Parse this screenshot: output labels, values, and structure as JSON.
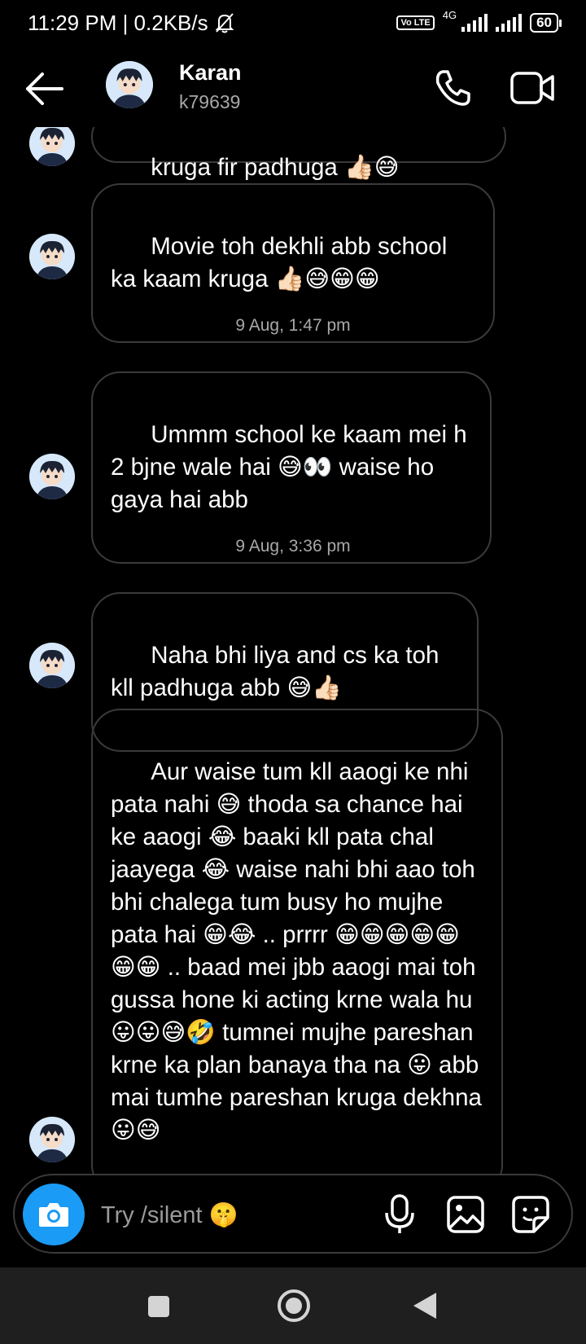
{
  "status_bar": {
    "time_speed": "11:29 PM | 0.2KB/s",
    "volte": "Vo LTE",
    "network": "4G",
    "battery": "60"
  },
  "header": {
    "name": "Karan",
    "username": "k79639"
  },
  "messages": [
    {
      "text": "kruga fir padhuga 👍🏻😅"
    },
    {
      "text": "Movie toh dekhli abb school ka kaam kruga 👍🏻😅😁😁"
    },
    {
      "text": "Ummm school ke kaam mei h 2 bjne wale hai 😅👀 waise ho gaya hai abb"
    },
    {
      "text": "Naha bhi liya and cs ka toh kll padhuga abb 😅👍🏻"
    },
    {
      "text": "Aur waise tum kll aaogi ke nhi pata nahi 😅 thoda sa chance hai ke aaogi 😂 baaki kll pata chal jaayega 😂 waise nahi bhi aao toh bhi chalega tum busy ho mujhe pata hai 😁😂 .. prrrr 😁😁😁😁😁😁😁 .. baad mei jbb aaogi mai toh gussa hone ki acting krne wala hu 😛😛😅🤣 tumnei mujhe pareshan krne ka plan banaya tha na 😛 abb mai tumhe pareshan kruga dekhna 😛😅"
    }
  ],
  "timestamps": [
    "9 Aug, 1:47 pm",
    "9 Aug, 3:36 pm"
  ],
  "composer": {
    "placeholder": "Try /silent 🤫"
  },
  "colors": {
    "background": "#000000",
    "bubble_border": "#3a3a3a",
    "accent_blue": "#1a9bf5",
    "secondary_text": "#a8a8a8",
    "nav_bar": "#1f1f1f"
  },
  "icons": {
    "back": "arrow-left-icon",
    "call": "phone-icon",
    "video": "video-camera-icon",
    "camera": "camera-icon",
    "mic": "microphone-icon",
    "gallery": "image-icon",
    "sticker": "sticker-icon"
  }
}
